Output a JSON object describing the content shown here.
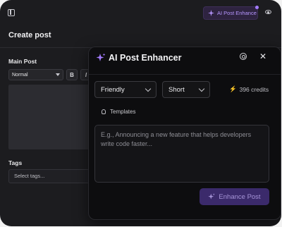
{
  "header": {
    "ai_chip_label": "AI Post Enhance",
    "accent_color": "#a47cff"
  },
  "page": {
    "title": "Create post",
    "main_post_label": "Main Post",
    "format_select": "Normal",
    "bold_label": "B",
    "italic_label": "I",
    "tags_label": "Tags",
    "tags_placeholder": "Select tags..."
  },
  "panel": {
    "title": "AI Post Enhancer",
    "tone": "Friendly",
    "length": "Short",
    "credits": "396 credits",
    "templates_label": "Templates",
    "prompt_placeholder": "E.g., Announcing a new feature that helps developers write code faster...",
    "enhance_label": "Enhance Post",
    "icons": [
      "sparkle-icon",
      "gear-icon",
      "close-icon",
      "bolt-icon",
      "bulb-icon"
    ]
  }
}
